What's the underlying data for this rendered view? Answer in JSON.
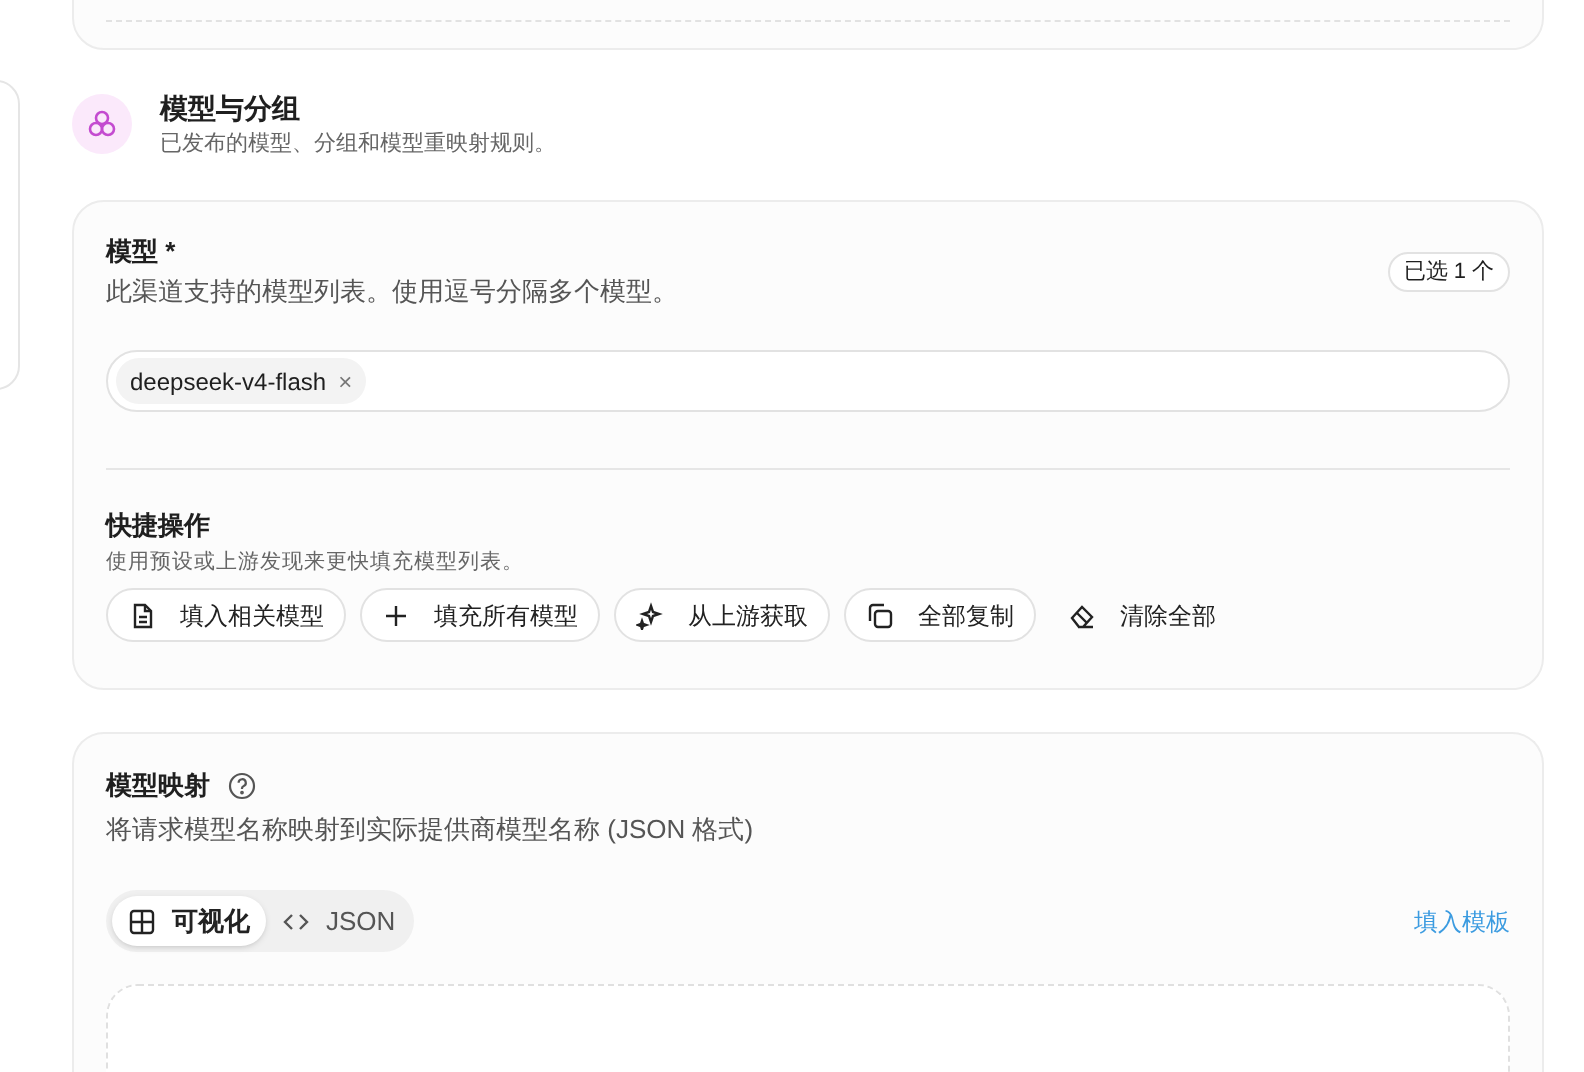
{
  "section": {
    "title": "模型与分组",
    "subtitle": "已发布的模型、分组和模型重映射规则。"
  },
  "models": {
    "label": "模型 *",
    "description": "此渠道支持的模型列表。使用逗号分隔多个模型。",
    "count_badge": "已选 1 个",
    "chips": [
      {
        "label": "deepseek-v4-flash",
        "remove": "×"
      }
    ]
  },
  "quick_actions": {
    "title": "快捷操作",
    "subtitle": "使用预设或上游发现来更快填充模型列表。",
    "buttons": [
      {
        "kind": "document",
        "label": "填入相关模型",
        "outlined": true
      },
      {
        "kind": "plus",
        "label": "填充所有模型",
        "outlined": true
      },
      {
        "kind": "sparkle",
        "label": "从上游获取",
        "outlined": true
      },
      {
        "kind": "copy",
        "label": "全部复制",
        "outlined": true
      },
      {
        "kind": "eraser",
        "label": "清除全部",
        "outlined": false
      }
    ]
  },
  "mapping": {
    "title": "模型映射",
    "description": "将请求模型名称映射到实际提供商模型名称 (JSON 格式)",
    "modes": [
      {
        "kind": "table",
        "label": "可视化",
        "selected": true
      },
      {
        "kind": "code",
        "label": "JSON",
        "selected": false
      }
    ],
    "template_link": "填入模板"
  }
}
